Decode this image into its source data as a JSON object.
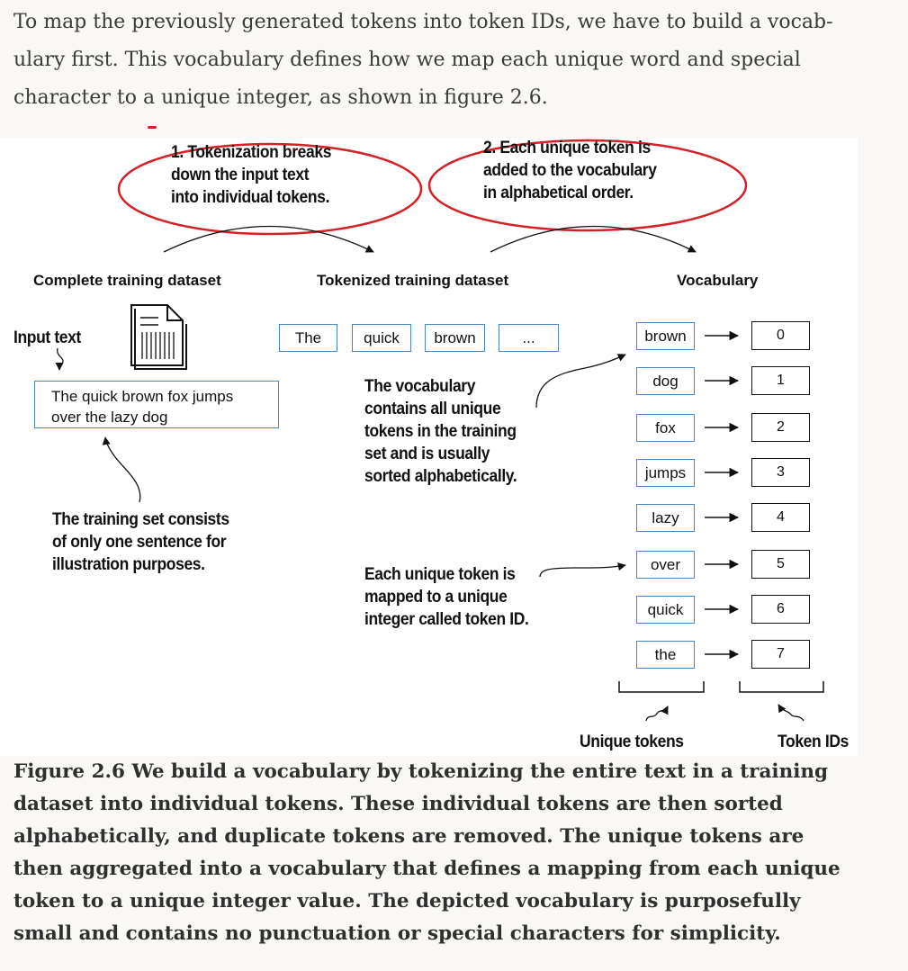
{
  "intro_paragraph": "To map the previously generated tokens into token IDs, we have to build a vocab-\nulary first. This vocabulary defines how we map each unique word and special\ncharacter to a unique integer, as shown in figure 2.6.",
  "figure": {
    "step1_label": "1. Tokenization breaks\n   down the input text\n   into individual tokens.",
    "step2_label": "2. Each unique token is\n   added to the vocabulary\n   in alphabetical order.",
    "headers": {
      "complete": "Complete training dataset",
      "tokenized": "Tokenized training dataset",
      "vocabulary": "Vocabulary"
    },
    "input_text_label": "Input text",
    "input_text": "The quick brown fox jumps\nover the lazy dog",
    "training_note": "The training set consists\nof only one sentence for\nillustration purposes.",
    "tokenized_tokens": [
      "The",
      "quick",
      "brown",
      "..."
    ],
    "vocab_note": "The vocabulary\ncontains all unique\ntokens in the training\nset and is usually\nsorted alphabetically.",
    "mapping_note": "Each unique token is\nmapped to a unique\ninteger called token ID.",
    "vocabulary": [
      {
        "token": "brown",
        "id": "0"
      },
      {
        "token": "dog",
        "id": "1"
      },
      {
        "token": "fox",
        "id": "2"
      },
      {
        "token": "jumps",
        "id": "3"
      },
      {
        "token": "lazy",
        "id": "4"
      },
      {
        "token": "over",
        "id": "5"
      },
      {
        "token": "quick",
        "id": "6"
      },
      {
        "token": "the",
        "id": "7"
      }
    ],
    "unique_tokens_label": "Unique tokens",
    "token_ids_label": "Token IDs",
    "colors": {
      "highlight": "#d42027",
      "box_border": "#4a86c8"
    }
  },
  "caption": "Figure 2.6 We build a vocabulary by tokenizing the entire text in a training\ndataset into individual tokens. These individual tokens are then sorted\nalphabetically, and duplicate tokens are removed. The unique tokens are\nthen aggregated into a vocabulary that defines a mapping from each unique\ntoken to a unique integer value. The depicted vocabulary is purposefully\nsmall and contains no punctuation or special characters for simplicity."
}
